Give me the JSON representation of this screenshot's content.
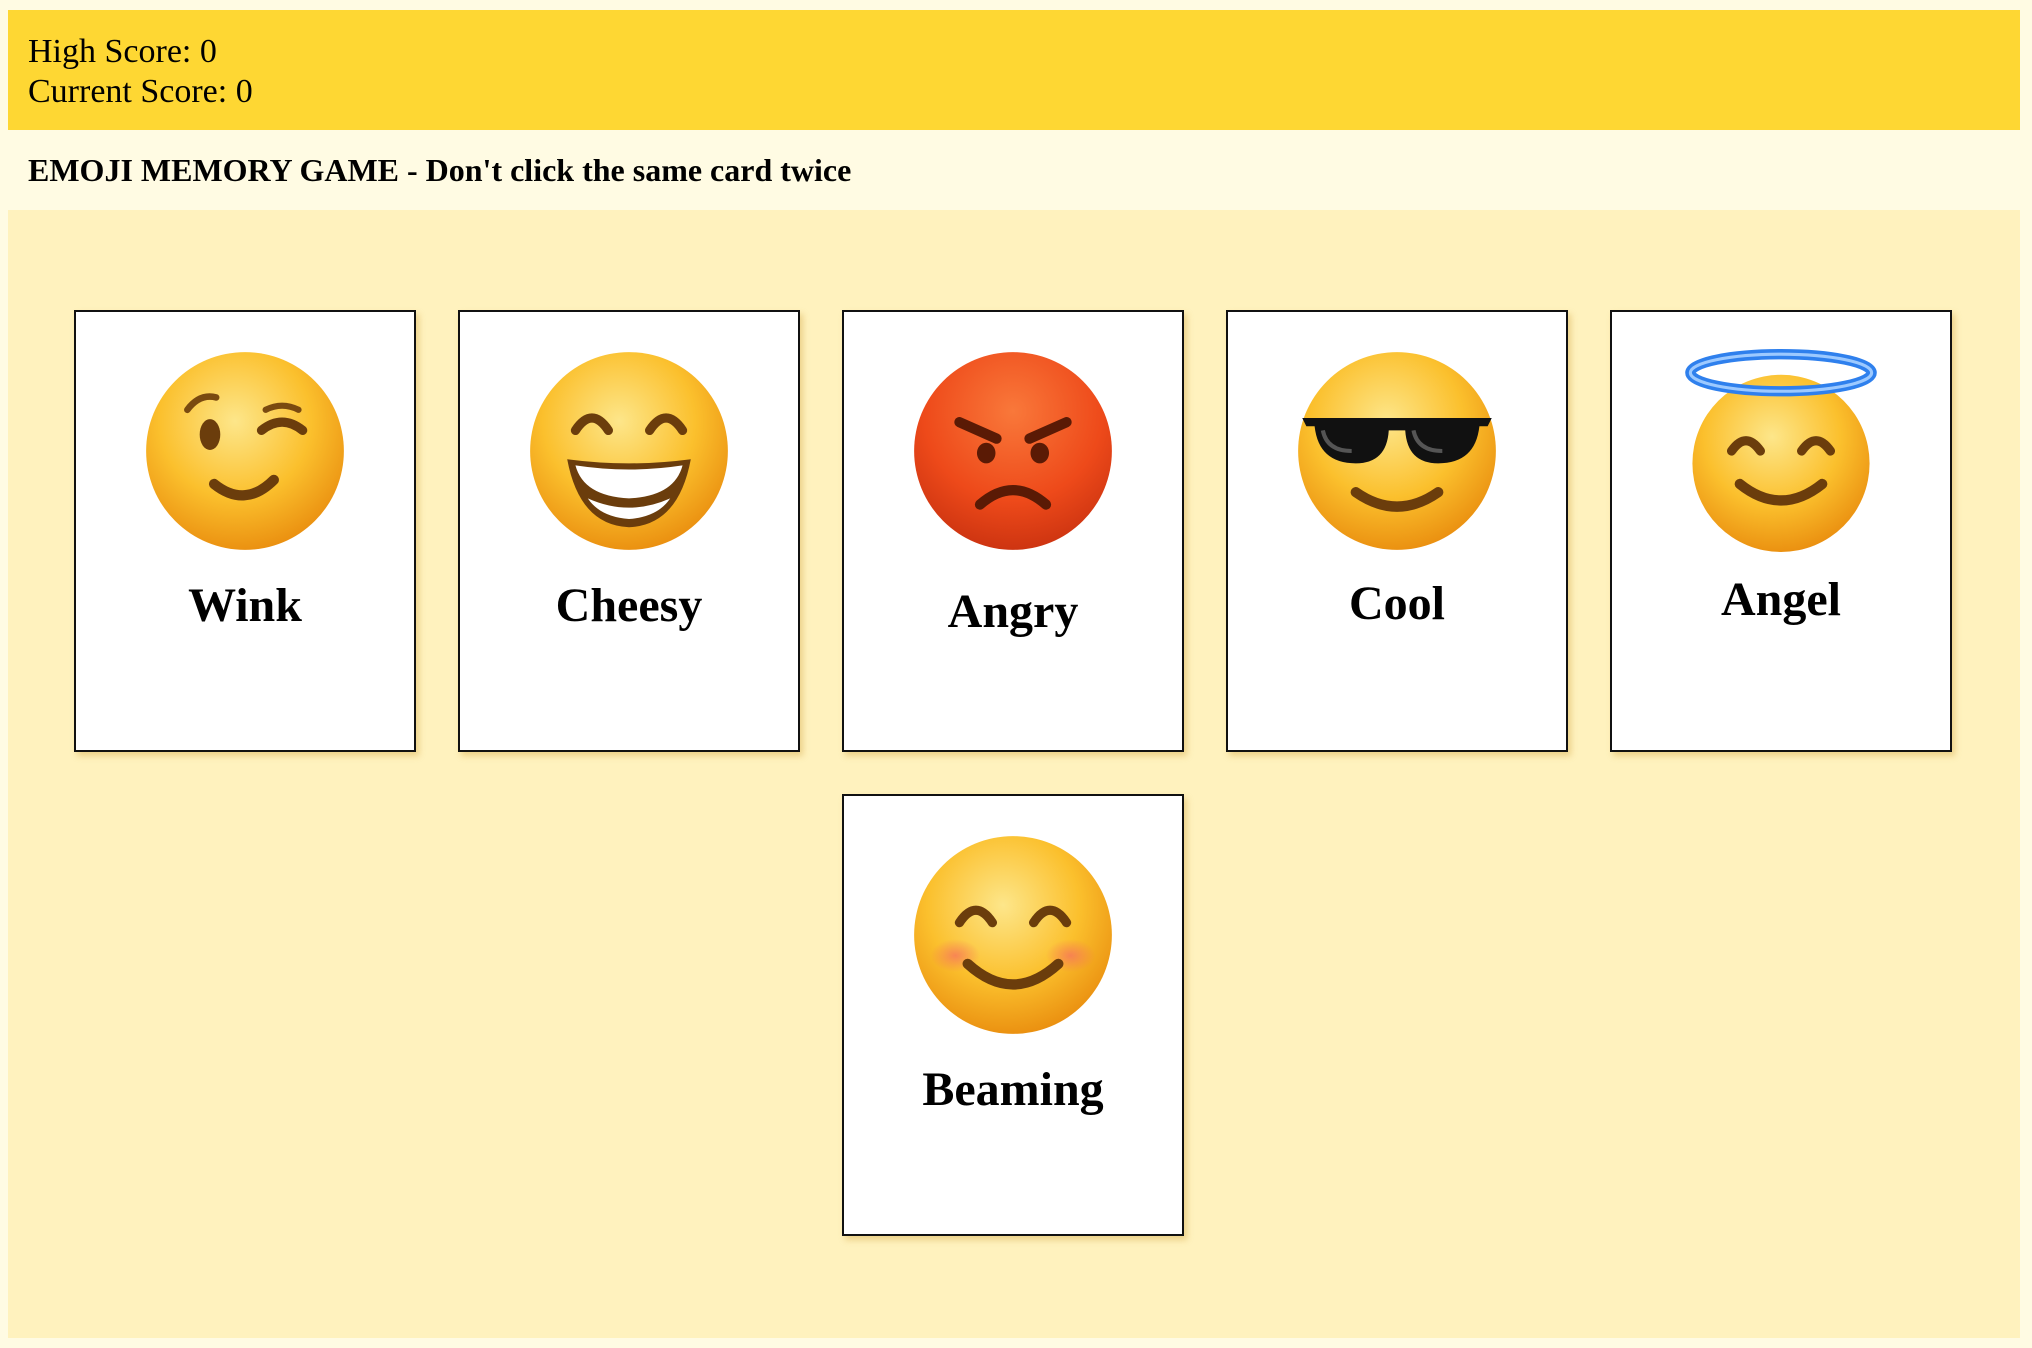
{
  "scoreboard": {
    "high_score_label": "High Score: 0",
    "current_score_label": "Current Score: 0"
  },
  "header": {
    "title": "EMOJI MEMORY GAME - Don't click the same card twice"
  },
  "cards": [
    {
      "label": "Wink",
      "emoji": "winking-face"
    },
    {
      "label": "Cheesy",
      "emoji": "grinning-face-with-smiling-eyes"
    },
    {
      "label": "Angry",
      "emoji": "angry-face"
    },
    {
      "label": "Cool",
      "emoji": "smiling-face-with-sunglasses"
    },
    {
      "label": "Angel",
      "emoji": "smiling-face-with-halo"
    },
    {
      "label": "Beaming",
      "emoji": "smiling-face-with-smiling-eyes"
    }
  ],
  "colors": {
    "score_bar": "#fed733",
    "title_bar": "#fffbe3",
    "board": "#fff2be",
    "card": "#ffffff",
    "emoji_yellow": "#fbc02d",
    "angry_red": "#f0501e"
  }
}
